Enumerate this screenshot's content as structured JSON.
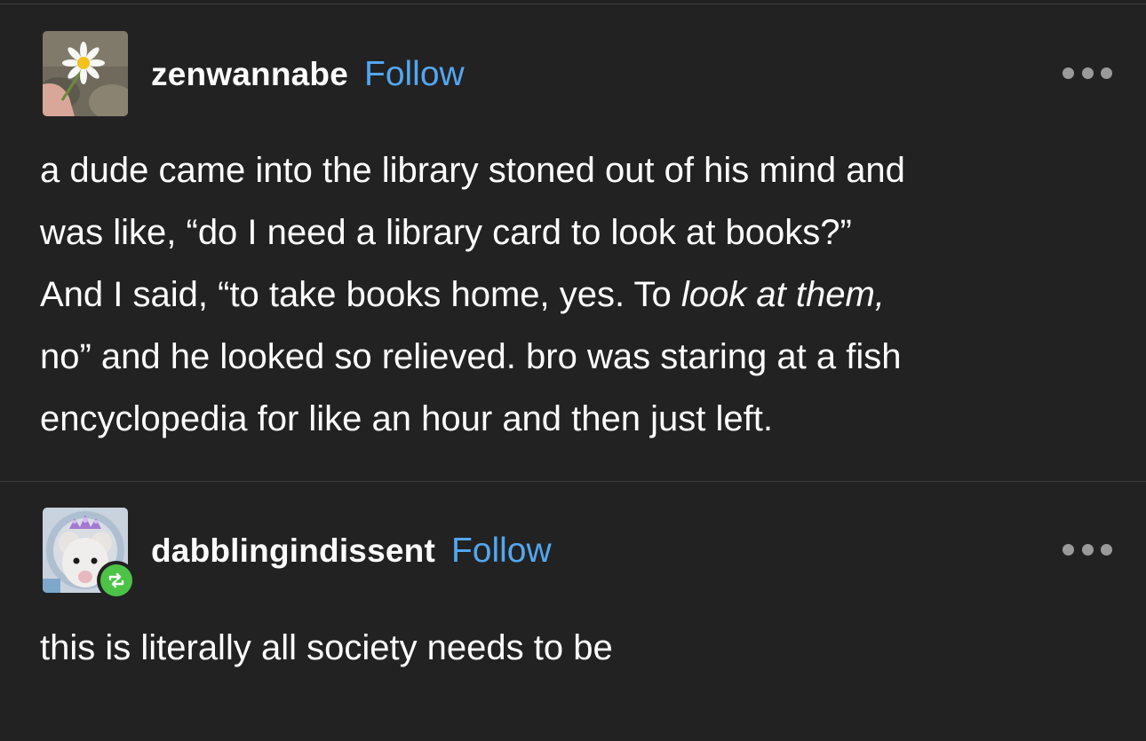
{
  "posts": [
    {
      "username": "zenwannabe",
      "follow_label": "Follow",
      "avatar_icon": "daisy-flower-avatar",
      "more_icon": "more-dots-icon",
      "body": {
        "line1": "a dude came into the library stoned out of his mind and",
        "line2": "was like, “do I need a library card to look at books?”",
        "line3_pre": "And I said, “to take books home, yes. To ",
        "line3_em": "look at them,",
        "line4": "no” and he looked so relieved. bro was staring at a fish",
        "line5": "encyclopedia for like an hour and then just left."
      }
    },
    {
      "username": "dabblingindissent",
      "follow_label": "Follow",
      "avatar_icon": "opossum-tiara-avatar",
      "badge_icon": "reblog-icon",
      "more_icon": "more-dots-icon",
      "body": {
        "line1": "this is literally all society needs to be"
      }
    }
  ],
  "colors": {
    "background": "#222222",
    "follow_link": "#53a7f0",
    "reblog_badge": "#4cc347",
    "text": "#ffffff"
  }
}
